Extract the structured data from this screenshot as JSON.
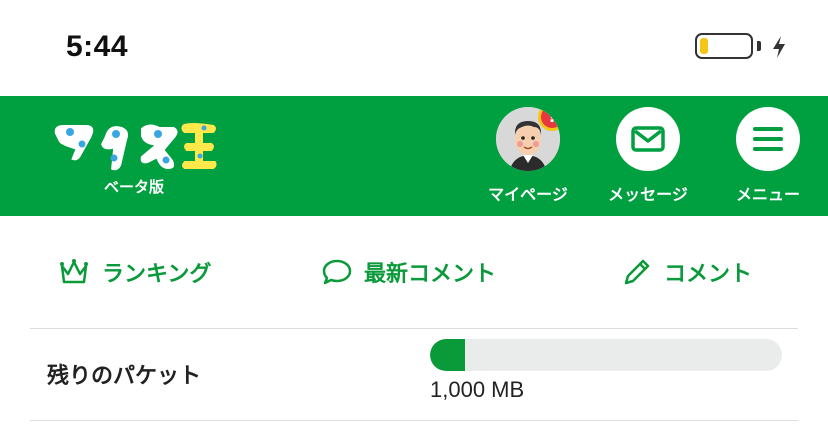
{
  "status_bar": {
    "time": "5:44",
    "battery_level": 0.15,
    "battery_color": "#f5c518",
    "charging": true
  },
  "header": {
    "background": "#00a040",
    "logo_text": "マイネ王",
    "beta_label": "ベータ版",
    "nav": [
      {
        "label": "マイページ",
        "icon": "avatar",
        "badge": "!"
      },
      {
        "label": "メッセージ",
        "icon": "envelope-icon"
      },
      {
        "label": "メニュー",
        "icon": "hamburger-icon"
      }
    ]
  },
  "tabs": [
    {
      "label": "ランキング",
      "icon": "crown-icon"
    },
    {
      "label": "最新コメント",
      "icon": "speech-bubble-icon"
    },
    {
      "label": "コメント",
      "icon": "pencil-icon"
    }
  ],
  "packet": {
    "label": "残りのパケット",
    "value": "1,000 MB",
    "fill_fraction": 0.1,
    "accent": "#0a9a3a"
  }
}
